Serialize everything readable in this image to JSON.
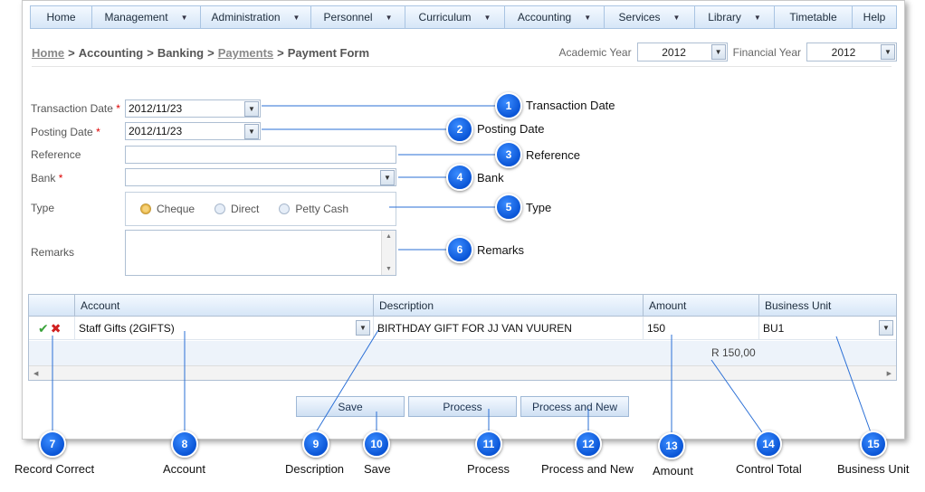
{
  "menu": [
    {
      "label": "Home",
      "has_caret": false
    },
    {
      "label": "Management",
      "has_caret": true
    },
    {
      "label": "Administration",
      "has_caret": true
    },
    {
      "label": "Personnel",
      "has_caret": true
    },
    {
      "label": "Curriculum",
      "has_caret": true
    },
    {
      "label": "Accounting",
      "has_caret": true
    },
    {
      "label": "Services",
      "has_caret": true
    },
    {
      "label": "Library",
      "has_caret": true
    },
    {
      "label": "Timetable",
      "has_caret": false
    },
    {
      "label": "Help",
      "has_caret": false
    }
  ],
  "breadcrumb": {
    "home": "Home",
    "sep1": ">",
    "accounting": "Accounting",
    "sep2": ">",
    "banking": "Banking",
    "sep3": ">",
    "payments": "Payments",
    "sep4": ">",
    "current": "Payment Form"
  },
  "years": {
    "academic_label": "Academic Year",
    "academic_value": "2012",
    "financial_label": "Financial Year",
    "financial_value": "2012"
  },
  "form": {
    "transaction_date_label": "Transaction Date",
    "transaction_date_value": "2012/11/23",
    "posting_date_label": "Posting Date",
    "posting_date_value": "2012/11/23",
    "reference_label": "Reference",
    "reference_value": "",
    "bank_label": "Bank",
    "bank_value": "",
    "type_label": "Type",
    "type_options": [
      "Cheque",
      "Direct",
      "Petty Cash"
    ],
    "type_selected": "Cheque",
    "remarks_label": "Remarks",
    "remarks_value": "",
    "required_mark": "*"
  },
  "grid": {
    "columns": [
      "Account",
      "Description",
      "Amount",
      "Business Unit"
    ],
    "rows": [
      {
        "account": "Staff Gifts (2GIFTS)",
        "description": "BIRTHDAY GIFT FOR JJ VAN VUUREN",
        "amount": "150",
        "business_unit": "BU1"
      }
    ],
    "control_total": "R 150,00"
  },
  "buttons": {
    "save": "Save",
    "process": "Process",
    "process_new": "Process and New"
  },
  "callouts": [
    {
      "num": "1",
      "text": "Transaction Date"
    },
    {
      "num": "2",
      "text": "Posting Date"
    },
    {
      "num": "3",
      "text": "Reference"
    },
    {
      "num": "4",
      "text": "Bank"
    },
    {
      "num": "5",
      "text": "Type"
    },
    {
      "num": "6",
      "text": "Remarks"
    },
    {
      "num": "7",
      "text": "Record Correct"
    },
    {
      "num": "8",
      "text": "Account"
    },
    {
      "num": "9",
      "text": "Description"
    },
    {
      "num": "10",
      "text": "Save"
    },
    {
      "num": "11",
      "text": "Process"
    },
    {
      "num": "12",
      "text": "Process and New"
    },
    {
      "num": "13",
      "text": "Amount"
    },
    {
      "num": "14",
      "text": "Control Total"
    },
    {
      "num": "15",
      "text": "Business Unit"
    }
  ],
  "colors": {
    "accent": "#0a55d6",
    "required": "#dd0000",
    "header_bg": "#d6e6f7"
  }
}
